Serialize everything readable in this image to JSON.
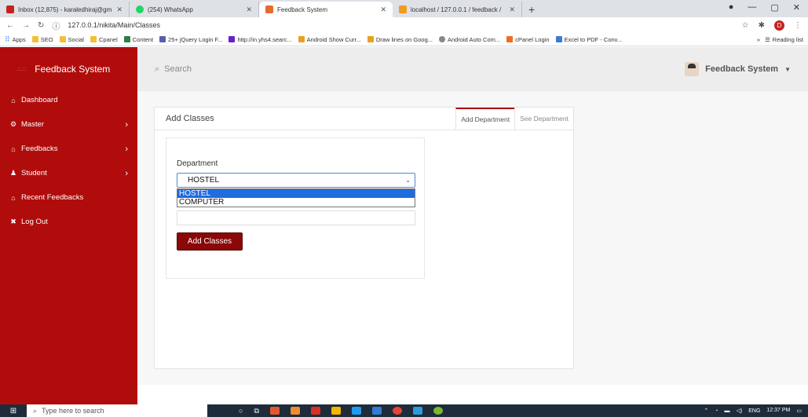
{
  "browser": {
    "tabs": [
      {
        "label": "Inbox (12,875) - karaledhiraj@gm",
        "color": "#c5221f"
      },
      {
        "label": "(254) WhatsApp",
        "color": "#25d366"
      },
      {
        "label": "Feedback System",
        "color": "#e86a2c",
        "active": true
      },
      {
        "label": "localhost / 127.0.0.1 / feedback /",
        "color": "#f39a1e"
      }
    ],
    "url": "127.0.0.1/nikita/Main/Classes",
    "profile_initial": "D",
    "bookmarks": [
      "Apps",
      "SEO",
      "Social",
      "Cpanel",
      "Content",
      "25+ jQuery Login F...",
      "http://in.yhs4.searc...",
      "Android Show Curr...",
      "Draw lines on Goog...",
      "Android Auto Com...",
      "cPanel Login",
      "Excel to PDF - Conv..."
    ],
    "reading_list": "Reading list"
  },
  "sidebar": {
    "brand": "Feedback System",
    "items": [
      {
        "label": "Dashboard",
        "icon": "home-icon",
        "glyph": "⌂",
        "has_children": false
      },
      {
        "label": "Master",
        "icon": "gear-icon",
        "glyph": "⚙",
        "has_children": true
      },
      {
        "label": "Feedbacks",
        "icon": "bank-icon",
        "glyph": "⌂",
        "has_children": true
      },
      {
        "label": "Student",
        "icon": "users-icon",
        "glyph": "♟",
        "has_children": true
      },
      {
        "label": "Recent Feedbacks",
        "icon": "bank-icon",
        "glyph": "⌂",
        "has_children": false
      },
      {
        "label": "Log Out",
        "icon": "close-icon",
        "glyph": "✖",
        "has_children": false
      }
    ]
  },
  "topnav": {
    "search_label": "Search",
    "user_name": "Feedback System"
  },
  "panel": {
    "title": "Add Classes",
    "tabs": [
      "Add Department",
      "See Department"
    ],
    "form": {
      "department_label": "Department",
      "department_value": "HOSTEL",
      "options": [
        "HOSTEL",
        "COMPUTER"
      ],
      "submit_label": "Add Classes"
    }
  },
  "taskbar": {
    "search_placeholder": "Type here to search",
    "lang": "ENG",
    "time": "12:37 PM"
  },
  "colors": {
    "sidebar": "#b10c0c",
    "button": "#8a0808",
    "option_highlight": "#1e6ce0"
  }
}
